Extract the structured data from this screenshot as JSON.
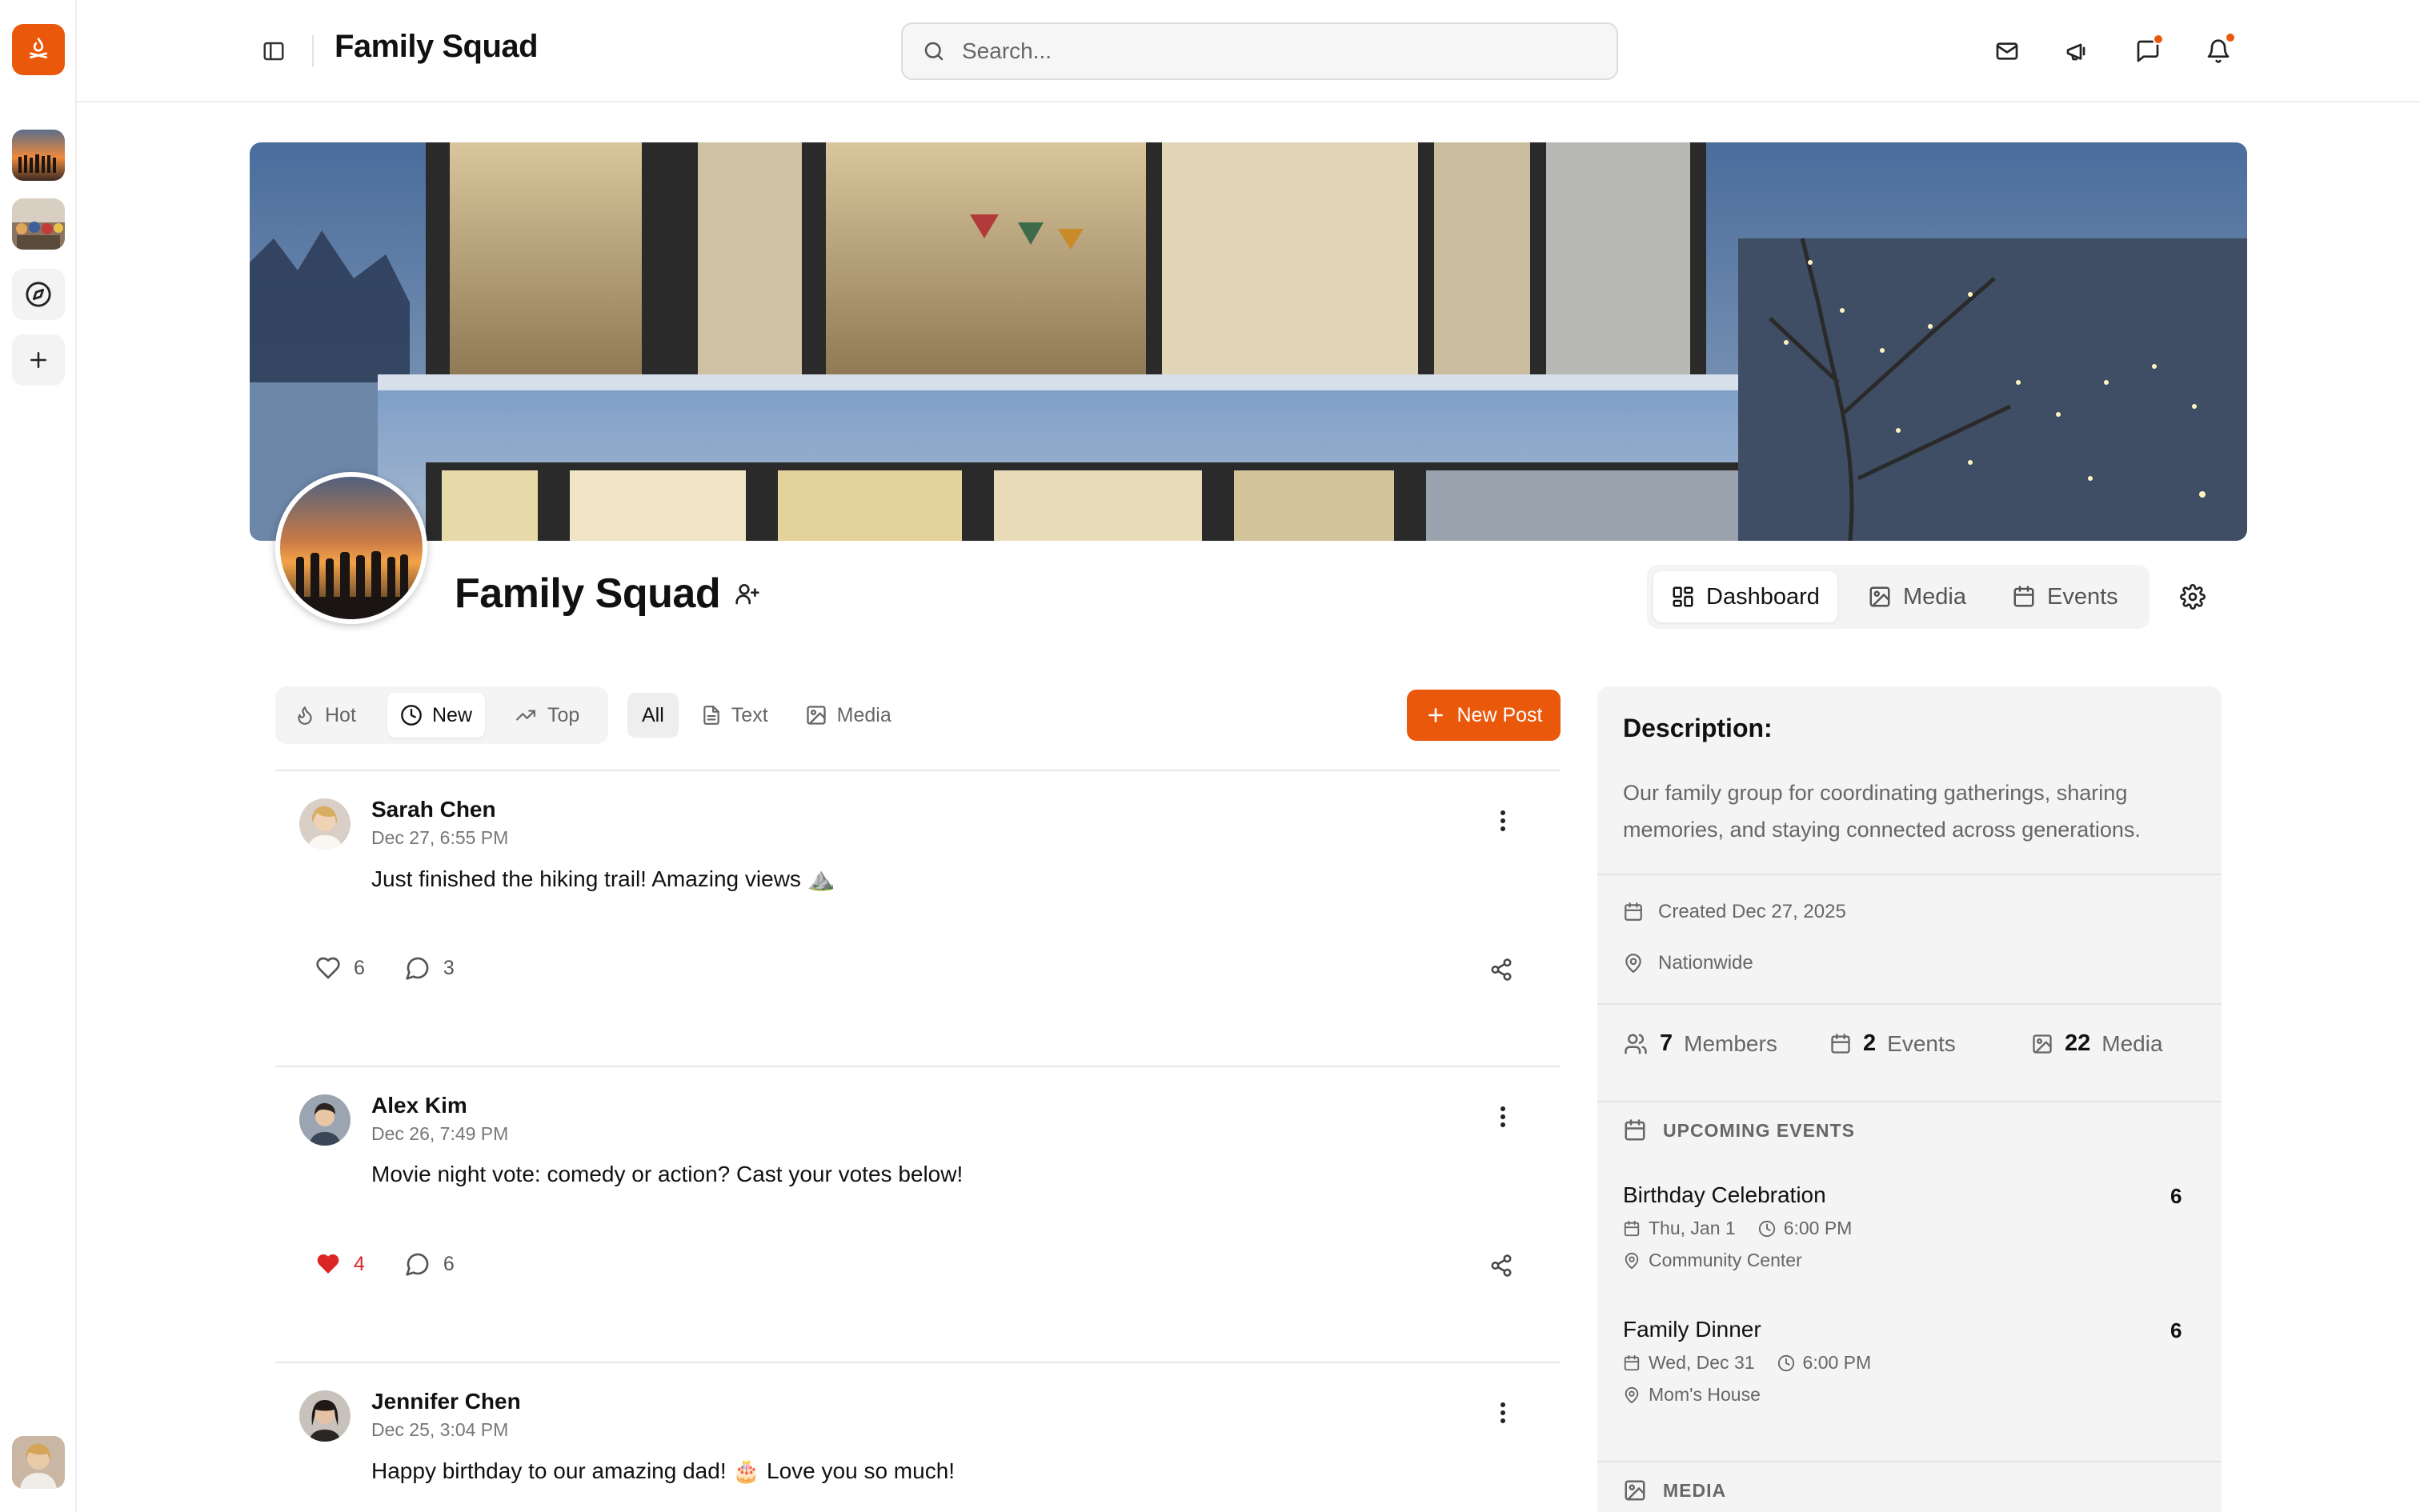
{
  "app": {
    "title": "Family Squad"
  },
  "search": {
    "placeholder": "Search..."
  },
  "group": {
    "name": "Family Squad",
    "tabs": [
      {
        "label": "Dashboard",
        "active": true
      },
      {
        "label": "Media",
        "active": false
      },
      {
        "label": "Events",
        "active": false
      }
    ]
  },
  "filters": {
    "sort": [
      {
        "label": "Hot"
      },
      {
        "label": "New",
        "active": true
      },
      {
        "label": "Top"
      }
    ],
    "types": [
      {
        "label": "All",
        "active": true
      },
      {
        "label": "Text"
      },
      {
        "label": "Media"
      }
    ],
    "new_post_label": "New Post"
  },
  "posts": [
    {
      "author": "Sarah Chen",
      "time": "Dec 27, 6:55 PM",
      "body": "Just finished the hiking trail! Amazing views ⛰️",
      "likes": "6",
      "comments": "3",
      "liked": false
    },
    {
      "author": "Alex Kim",
      "time": "Dec 26, 7:49 PM",
      "body": "Movie night vote: comedy or action? Cast your votes below!",
      "likes": "4",
      "comments": "6",
      "liked": true
    },
    {
      "author": "Jennifer Chen",
      "time": "Dec 25, 3:04 PM",
      "body": "Happy birthday to our amazing dad! 🎂 Love you so much!"
    }
  ],
  "sidebar": {
    "description_heading": "Description:",
    "description": "Our family group for coordinating gatherings, sharing memories, and staying connected across generations.",
    "created": "Created Dec 27, 2025",
    "location": "Nationwide",
    "stats": {
      "members_count": "7",
      "members_label": "Members",
      "events_count": "2",
      "events_label": "Events",
      "media_count": "22",
      "media_label": "Media"
    },
    "upcoming_heading": "UPCOMING EVENTS",
    "events": [
      {
        "title": "Birthday Celebration",
        "count": "6",
        "date": "Thu, Jan 1",
        "time": "6:00 PM",
        "place": "Community Center"
      },
      {
        "title": "Family Dinner",
        "count": "6",
        "date": "Wed, Dec 31",
        "time": "6:00 PM",
        "place": "Mom's House"
      }
    ],
    "media_heading": "MEDIA"
  },
  "colors": {
    "accent": "#ea580c",
    "liked": "#dc2626",
    "card_bg": "#f4f4f4"
  }
}
